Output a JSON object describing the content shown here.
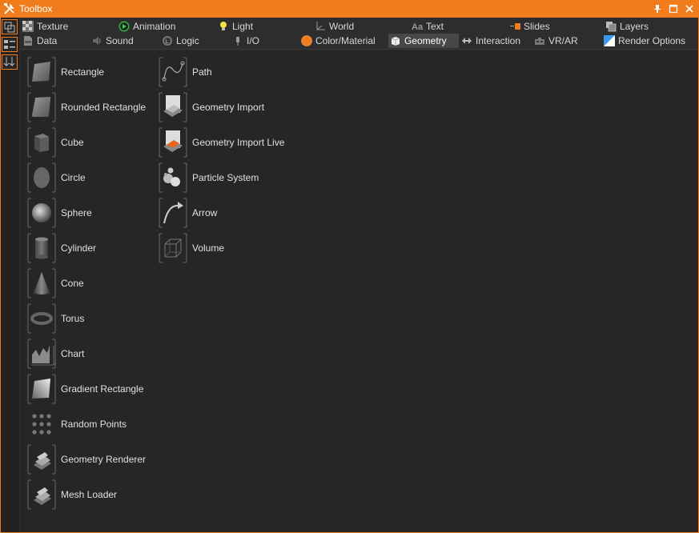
{
  "window": {
    "title": "Toolbox",
    "accent": "#f07c1c"
  },
  "titlebar": {
    "buttons": [
      {
        "name": "pin-icon"
      },
      {
        "name": "maximize-icon"
      },
      {
        "name": "close-icon"
      }
    ]
  },
  "sidebar": {
    "buttons": [
      {
        "name": "copy-icon"
      },
      {
        "name": "list-view-icon"
      },
      {
        "name": "sort-icon"
      }
    ]
  },
  "tabs": {
    "row1": [
      {
        "label": "Texture",
        "icon": "checker-icon"
      },
      {
        "label": "Animation",
        "icon": "play-icon"
      },
      {
        "label": "Light",
        "icon": "bulb-icon"
      },
      {
        "label": "World",
        "icon": "axis-icon"
      },
      {
        "label": "Text",
        "icon": "text-icon",
        "prefix": "Aa"
      },
      {
        "label": "Slides",
        "icon": "slides-icon"
      },
      {
        "label": "Layers",
        "icon": "layers-icon"
      }
    ],
    "row2": [
      {
        "label": "Data",
        "icon": "data-icon"
      },
      {
        "label": "Sound",
        "icon": "speaker-icon"
      },
      {
        "label": "Logic",
        "icon": "logic-icon"
      },
      {
        "label": "I/O",
        "icon": "plug-icon"
      },
      {
        "label": "Color/Material",
        "icon": "color-icon"
      },
      {
        "label": "Geometry",
        "icon": "cube-icon",
        "active": true
      },
      {
        "label": "Interaction",
        "icon": "interaction-icon"
      },
      {
        "label": "VR/AR",
        "icon": "vr-icon"
      },
      {
        "label": "Render Options",
        "icon": "render-icon"
      }
    ]
  },
  "items": {
    "col1": [
      {
        "label": "Rectangle",
        "icon": "rectangle-icon"
      },
      {
        "label": "Rounded Rectangle",
        "icon": "rounded-rectangle-icon"
      },
      {
        "label": "Cube",
        "icon": "cube-shape-icon"
      },
      {
        "label": "Circle",
        "icon": "circle-icon"
      },
      {
        "label": "Sphere",
        "icon": "sphere-icon"
      },
      {
        "label": "Cylinder",
        "icon": "cylinder-icon"
      },
      {
        "label": "Cone",
        "icon": "cone-icon"
      },
      {
        "label": "Torus",
        "icon": "torus-icon"
      },
      {
        "label": "Chart",
        "icon": "chart-icon"
      },
      {
        "label": "Gradient Rectangle",
        "icon": "gradient-rectangle-icon"
      },
      {
        "label": "Random Points",
        "icon": "random-points-icon"
      },
      {
        "label": "Geometry Renderer",
        "icon": "geometry-renderer-icon"
      },
      {
        "label": "Mesh Loader",
        "icon": "mesh-loader-icon"
      }
    ],
    "col2": [
      {
        "label": "Path",
        "icon": "path-icon"
      },
      {
        "label": "Geometry Import",
        "icon": "geometry-import-icon"
      },
      {
        "label": "Geometry Import Live",
        "icon": "geometry-import-live-icon"
      },
      {
        "label": "Particle System",
        "icon": "particle-system-icon"
      },
      {
        "label": "Arrow",
        "icon": "arrow-icon"
      },
      {
        "label": "Volume",
        "icon": "volume-icon"
      }
    ]
  }
}
